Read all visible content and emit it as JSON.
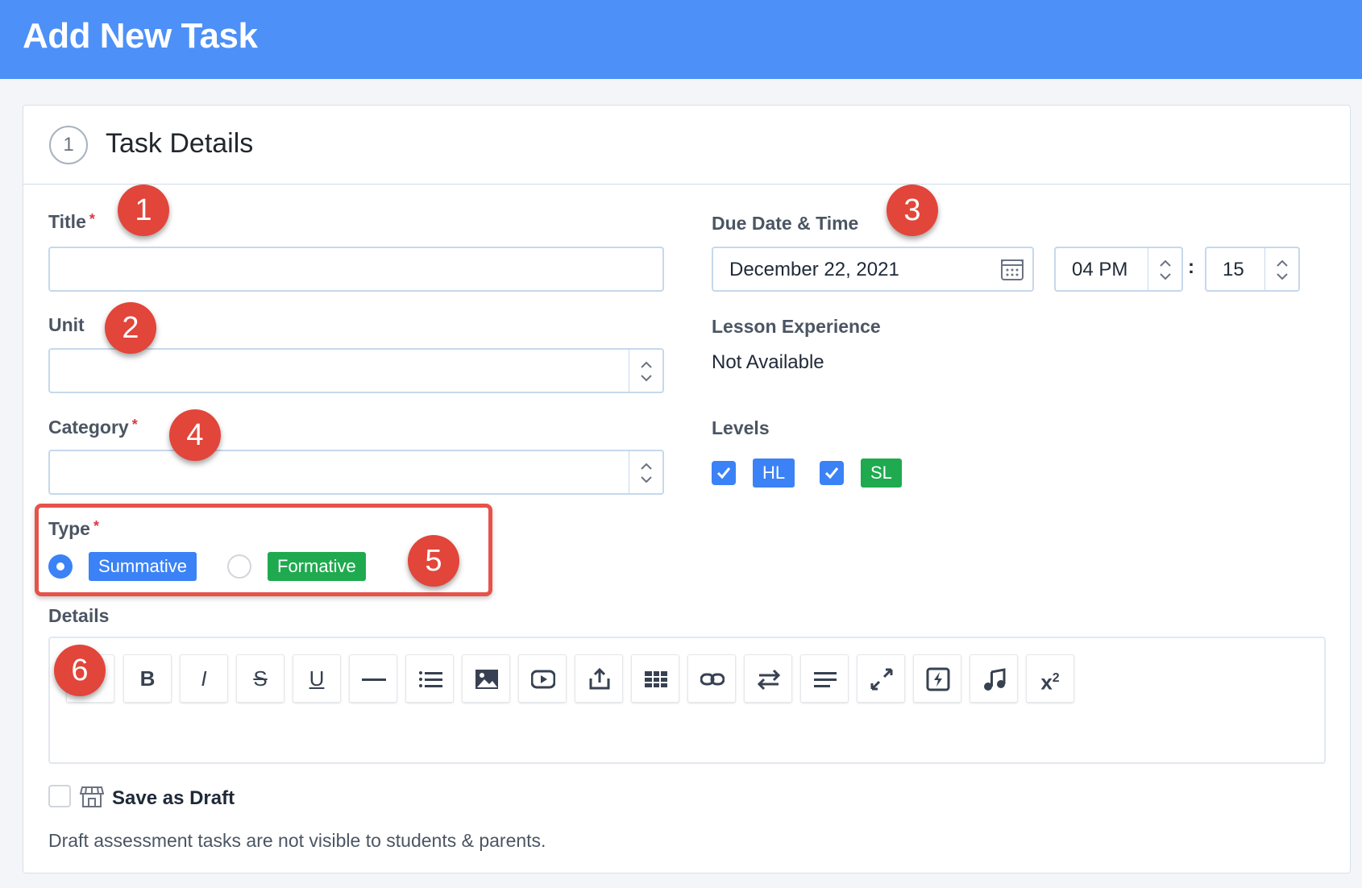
{
  "header": {
    "title": "Add New Task"
  },
  "section": {
    "step": "1",
    "title": "Task Details"
  },
  "form": {
    "title": {
      "label": "Title",
      "required": "*",
      "value": ""
    },
    "unit": {
      "label": "Unit",
      "value": ""
    },
    "category": {
      "label": "Category",
      "required": "*",
      "value": ""
    },
    "type": {
      "label": "Type",
      "required": "*",
      "options": [
        "Summative",
        "Formative"
      ],
      "selected": "Summative"
    },
    "details": {
      "label": "Details"
    },
    "due": {
      "label": "Due Date & Time",
      "date": "December 22, 2021",
      "hour": "04 PM",
      "separator": ":",
      "minute": "15"
    },
    "lesson": {
      "label": "Lesson Experience",
      "value": "Not Available"
    },
    "levels": {
      "label": "Levels",
      "items": [
        {
          "name": "HL",
          "checked": true
        },
        {
          "name": "SL",
          "checked": true
        }
      ]
    },
    "draft": {
      "label": "Save as Draft",
      "checked": false,
      "note": "Draft assessment tasks are not visible to students & parents."
    }
  },
  "toolbar": {
    "bold": "B",
    "italic": "I",
    "strike": "S",
    "underline": "U",
    "superscript": "x",
    "superscript_exp": "2"
  },
  "annotations": [
    "1",
    "2",
    "3",
    "4",
    "5",
    "6"
  ],
  "colors": {
    "header_bg": "#4d90f7",
    "badge_blue": "#3b82f6",
    "badge_green": "#1faa4f",
    "annotation_red": "#e2453a"
  }
}
